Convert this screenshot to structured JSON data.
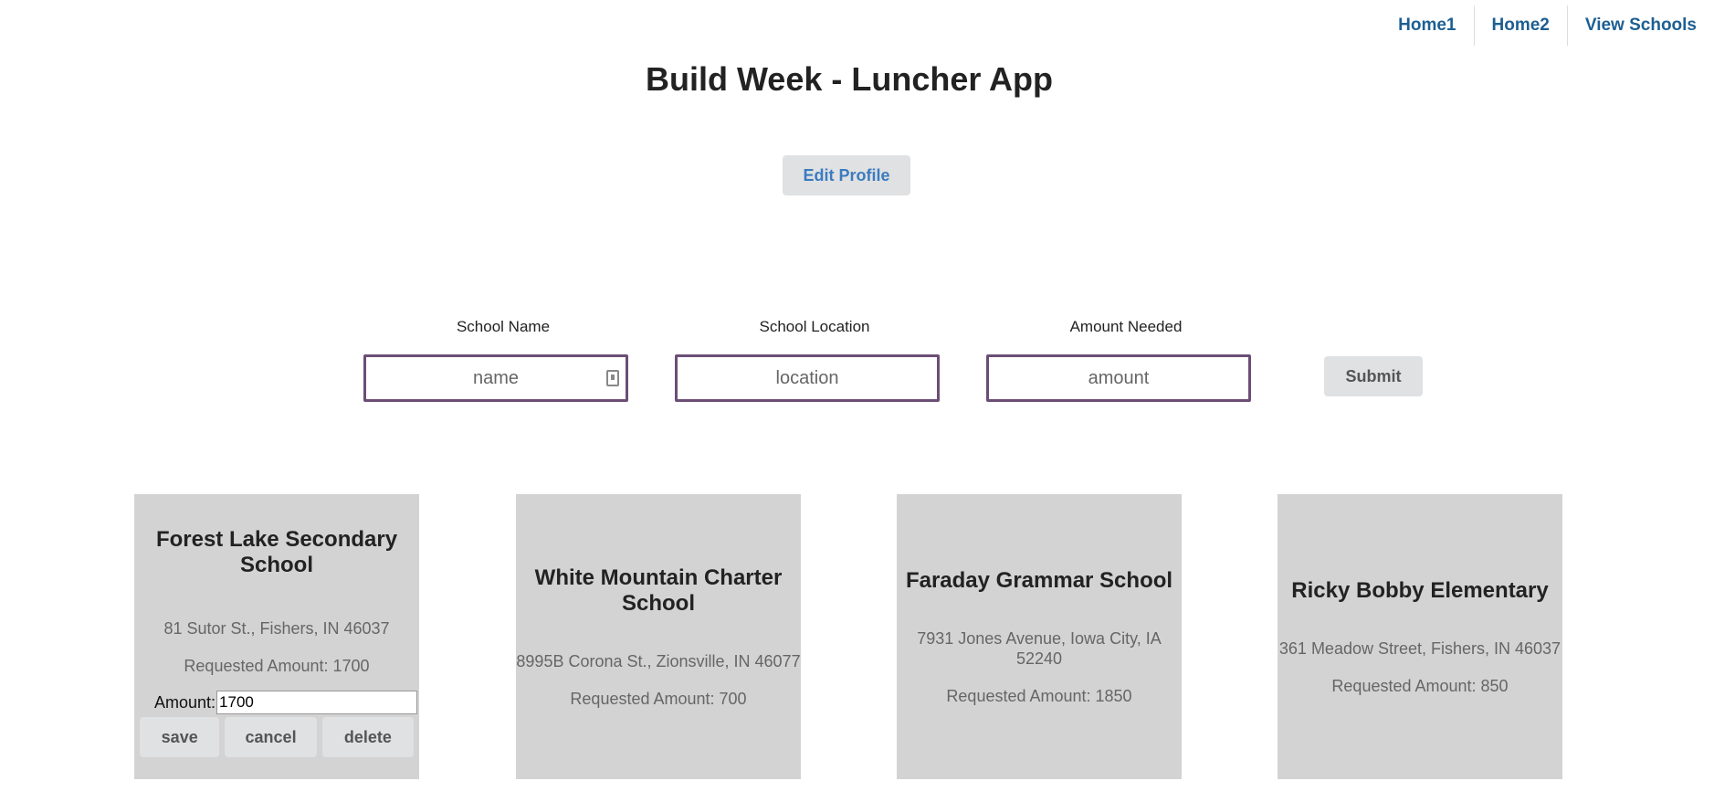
{
  "nav": {
    "items": [
      {
        "label": "Home1"
      },
      {
        "label": "Home2"
      },
      {
        "label": "View Schools"
      }
    ]
  },
  "header": {
    "title": "Build Week - Luncher App"
  },
  "profile": {
    "edit_label": "Edit Profile"
  },
  "form": {
    "name_label": "School Name",
    "name_placeholder": "name",
    "location_label": "School Location",
    "location_placeholder": "location",
    "amount_label": "Amount Needed",
    "amount_placeholder": "amount",
    "submit_label": "Submit"
  },
  "schools": [
    {
      "name": "Forest Lake Secondary School",
      "address": "81 Sutor St., Fishers, IN 46037",
      "requested": "Requested Amount: 1700",
      "edit": {
        "amount_label": "Amount:",
        "amount_value": "1700",
        "save_label": "save",
        "cancel_label": "cancel",
        "delete_label": "delete"
      }
    },
    {
      "name": "White Mountain Charter School",
      "address": "8995B Corona St., Zionsville, IN 46077",
      "requested": "Requested Amount: 700"
    },
    {
      "name": "Faraday Grammar School",
      "address": "7931 Jones Avenue, Iowa City, IA 52240",
      "requested": "Requested Amount: 1850"
    },
    {
      "name": "Ricky Bobby Elementary",
      "address": "361 Meadow Street, Fishers, IN 46037",
      "requested": "Requested Amount: 850"
    }
  ],
  "colors": {
    "nav_link": "#1d5f93",
    "input_border": "#6b4e75",
    "card_bg": "#d3d3d3",
    "button_bg": "#e0e1e2",
    "edit_profile_text": "#3b7bc0"
  }
}
